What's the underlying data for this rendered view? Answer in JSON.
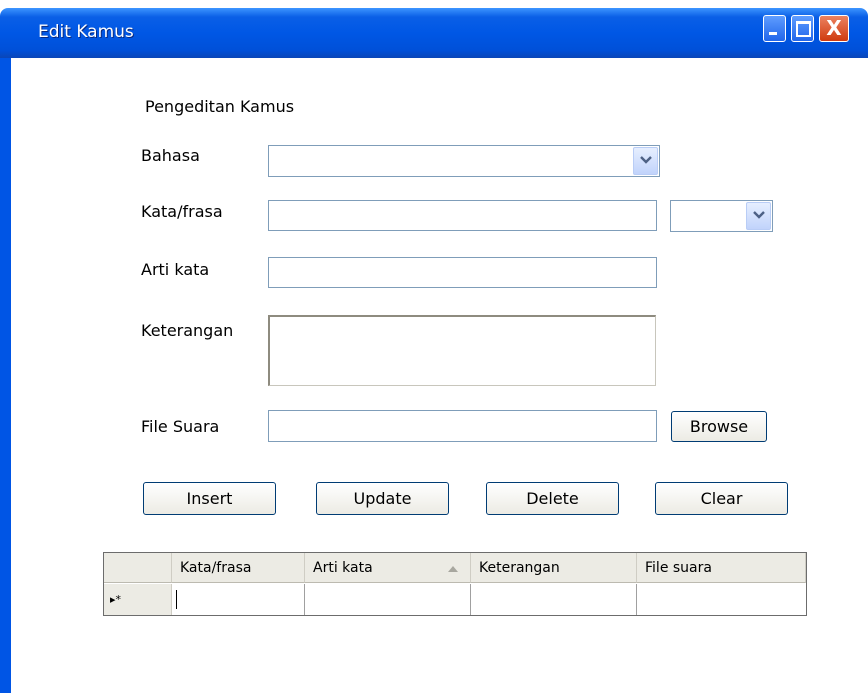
{
  "window": {
    "title": "Edit Kamus",
    "close_glyph": "X"
  },
  "form": {
    "heading": "Pengeditan Kamus",
    "bahasa_label": "Bahasa",
    "kata_label": "Kata/frasa",
    "arti_label": "Arti kata",
    "keterangan_label": "Keterangan",
    "file_suara_label": "File Suara",
    "browse_label": "Browse"
  },
  "buttons": {
    "insert": "Insert",
    "update": "Update",
    "delete": "Delete",
    "clear": "Clear"
  },
  "grid": {
    "columns": [
      "Kata/frasa",
      "Arti kata",
      "Keterangan",
      "File suara"
    ],
    "row_indicator": "▸*",
    "sort_column": "Arti kata"
  },
  "colors": {
    "titlebar": "#0057e5",
    "close_button": "#cf3b10",
    "dropdown_arrow": "#4d6185"
  },
  "icons": [
    "minimize-icon",
    "maximize-icon",
    "close-icon",
    "chevron-down-icon",
    "sort-asc-icon",
    "new-row-icon"
  ]
}
